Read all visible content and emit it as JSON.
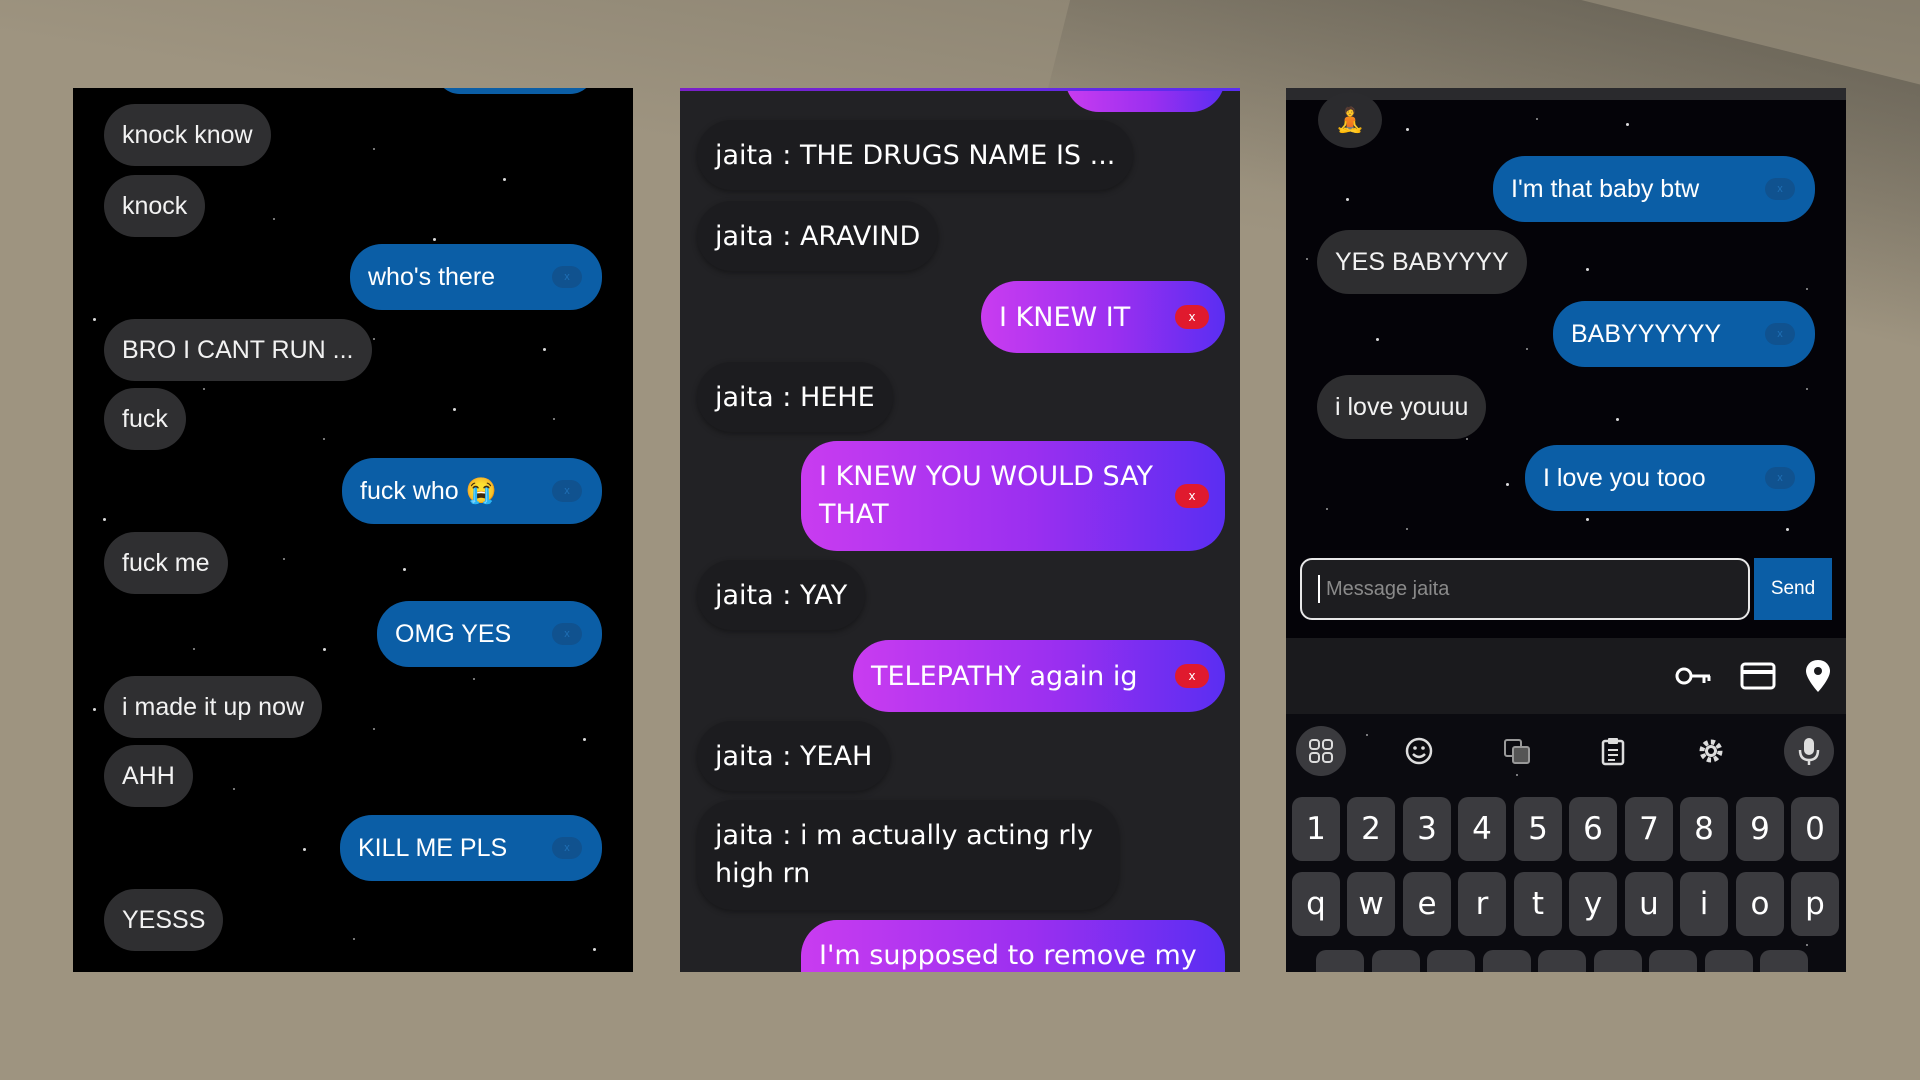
{
  "panel1": {
    "messages": [
      {
        "side": "received",
        "text": "knock know"
      },
      {
        "side": "received",
        "text": "knock"
      },
      {
        "side": "sent",
        "text": "who's there",
        "x": "x"
      },
      {
        "side": "received",
        "text": "BRO I CANT RUN ..."
      },
      {
        "side": "received",
        "text": "fuck"
      },
      {
        "side": "sent",
        "text": "fuck who 😭",
        "x": "x"
      },
      {
        "side": "received",
        "text": "fuck me"
      },
      {
        "side": "sent",
        "text": "OMG YES",
        "x": "x"
      },
      {
        "side": "received",
        "text": "i made it up now"
      },
      {
        "side": "received",
        "text": "AHH"
      },
      {
        "side": "sent",
        "text": "KILL ME PLS",
        "x": "x"
      },
      {
        "side": "received",
        "text": "YESSS"
      }
    ]
  },
  "panel2": {
    "messages": [
      {
        "side": "received",
        "text": "jaita : THE DRUGS NAME IS ..."
      },
      {
        "side": "received",
        "text": "jaita : ARAVIND"
      },
      {
        "side": "sent",
        "text": "I KNEW IT",
        "x": "x"
      },
      {
        "side": "received",
        "text": "jaita : HEHE"
      },
      {
        "side": "sent",
        "text": "I KNEW YOU WOULD SAY THAT",
        "x": "x"
      },
      {
        "side": "received",
        "text": "jaita : YAY"
      },
      {
        "side": "sent",
        "text": "TELEPATHY again ig",
        "x": "x"
      },
      {
        "side": "received",
        "text": "jaita : YEAH"
      },
      {
        "side": "received",
        "text": "jaita : i m actually acting rly high rn"
      },
      {
        "side": "sent",
        "text": "I'm supposed to remove my"
      }
    ]
  },
  "panel3": {
    "avatar": "🧘",
    "messages": [
      {
        "side": "sent",
        "text": "I'm that baby btw",
        "x": "x"
      },
      {
        "side": "received",
        "text": "YES BABYYYY"
      },
      {
        "side": "sent",
        "text": "BABYYYYYY",
        "x": "x"
      },
      {
        "side": "received",
        "text": "i love youuu"
      },
      {
        "side": "sent",
        "text": "I love you tooo",
        "x": "x"
      }
    ],
    "input": {
      "placeholder": "Message jaita",
      "value": ""
    },
    "send_label": "Send",
    "keyboard": {
      "number_row": [
        "1",
        "2",
        "3",
        "4",
        "5",
        "6",
        "7",
        "8",
        "9",
        "0"
      ],
      "letter_row": [
        "q",
        "w",
        "e",
        "r",
        "t",
        "y",
        "u",
        "i",
        "o",
        "p"
      ]
    }
  },
  "colors": {
    "sent_blue": "#0b5ea6",
    "sent_gradient_start": "#c93cf0",
    "sent_gradient_end": "#5a2ef2",
    "delete_red": "#e01a2e"
  }
}
